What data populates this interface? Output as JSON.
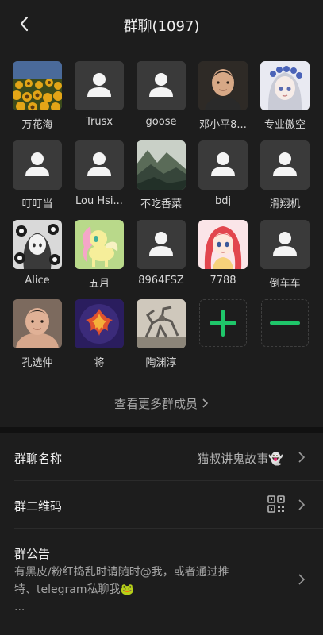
{
  "header": {
    "title": "群聊(1097)",
    "back_icon": "back-chevron-icon"
  },
  "members": [
    {
      "name": "万花海",
      "avatar": "sunflower-field-photo"
    },
    {
      "name": "Trusx",
      "avatar": "default-person-icon"
    },
    {
      "name": "goose",
      "avatar": "default-person-icon"
    },
    {
      "name": "邓小平8...",
      "avatar": "portrait-photo"
    },
    {
      "name": "专业傲空",
      "avatar": "anime-girl-flowers"
    },
    {
      "name": "叮叮当",
      "avatar": "default-person-icon"
    },
    {
      "name": "Lou Hsi...",
      "avatar": "default-person-icon"
    },
    {
      "name": "不吃香菜",
      "avatar": "misty-mountains-photo"
    },
    {
      "name": "bdj",
      "avatar": "default-person-icon"
    },
    {
      "name": "滑翔机",
      "avatar": "default-person-icon"
    },
    {
      "name": "Alice",
      "avatar": "anime-monochrome-flowers"
    },
    {
      "name": "五月",
      "avatar": "pink-pony-cartoon"
    },
    {
      "name": "8964FSZ",
      "avatar": "default-person-icon"
    },
    {
      "name": "7788",
      "avatar": "anime-redhead-girl"
    },
    {
      "name": "倒车车",
      "avatar": "default-person-icon"
    },
    {
      "name": "孔选仲",
      "avatar": "man-photo"
    },
    {
      "name": "将",
      "avatar": "phoenix-emblem"
    },
    {
      "name": "陶渊淳",
      "avatar": "robot-sculpture-photo"
    }
  ],
  "actions": {
    "add_icon": "plus-icon",
    "remove_icon": "minus-icon"
  },
  "more_members": "查看更多群成员",
  "group_name": {
    "label": "群聊名称",
    "value": "猫叔讲鬼故事",
    "value_emoji": "👻"
  },
  "qr_code": {
    "label": "群二维码",
    "icon": "qr-code-icon"
  },
  "announcement": {
    "label": "群公告",
    "line1": "有黑皮/粉红捣乱时请随时@我，或者通过推",
    "line2": "特、telegram私聊我🐸",
    "line3": "..."
  },
  "colors": {
    "accent": "#1fc66a",
    "background": "#111111",
    "panel": "#1d1d1d"
  }
}
